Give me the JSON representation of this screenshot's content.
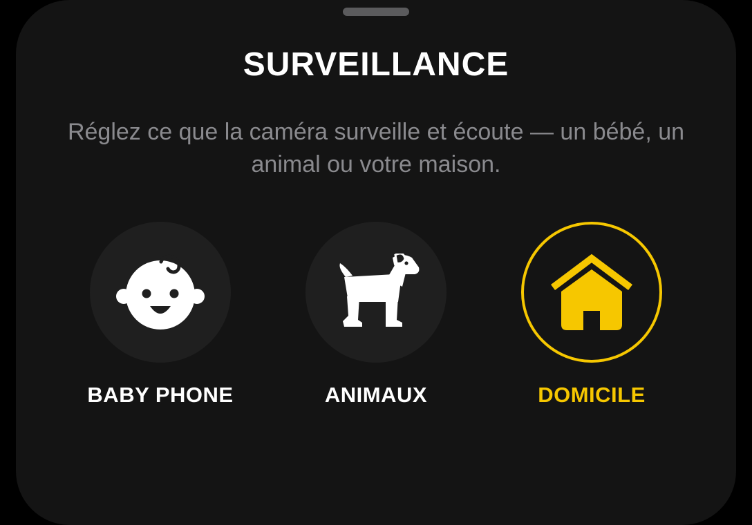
{
  "header": {
    "title": "SURVEILLANCE",
    "description": "Réglez ce que la caméra surveille et écoute — un bébé, un animal ou votre maison."
  },
  "modes": [
    {
      "label": "BABY PHONE",
      "icon": "baby-face-icon",
      "selected": false
    },
    {
      "label": "ANIMAUX",
      "icon": "dog-icon",
      "selected": false
    },
    {
      "label": "DOMICILE",
      "icon": "house-icon",
      "selected": true
    }
  ],
  "colors": {
    "background": "#000000",
    "sheet": "#141414",
    "circle": "#1f1f1f",
    "accent": "#f6c700",
    "text_primary": "#ffffff",
    "text_secondary": "#8a8a8e"
  }
}
